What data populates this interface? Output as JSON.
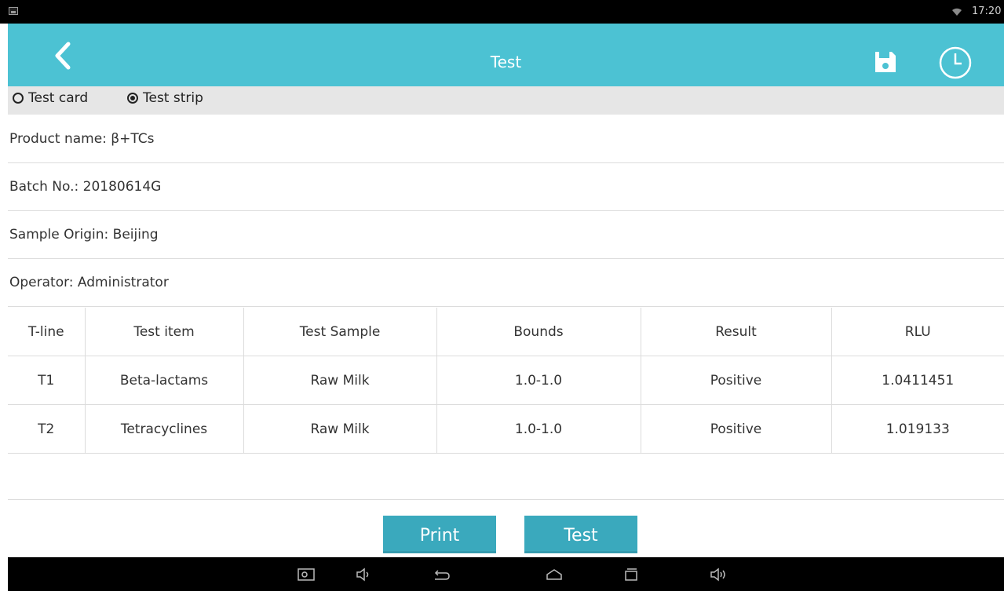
{
  "status_bar": {
    "time": "17:20"
  },
  "app_bar": {
    "title": "Test"
  },
  "mode": {
    "option_card": "Test card",
    "option_strip": "Test strip",
    "selected": "Test strip"
  },
  "info": {
    "product": "Product name: β+TCs",
    "batch": "Batch No.: 20180614G",
    "origin": "Sample Origin: Beijing",
    "operator": "Operator: Administrator"
  },
  "table": {
    "headers": [
      "T-line",
      "Test item",
      "Test Sample",
      "Bounds",
      "Result",
      "RLU"
    ],
    "rows": [
      [
        "T1",
        "Beta-lactams",
        "Raw Milk",
        "1.0-1.0",
        "Positive",
        "1.0411451"
      ],
      [
        "T2",
        "Tetracyclines",
        "Raw Milk",
        "1.0-1.0",
        "Positive",
        "1.019133"
      ]
    ]
  },
  "actions": {
    "print": "Print",
    "test": "Test"
  },
  "icons": {
    "back": "chevron-left-icon",
    "save": "floppy-disk-icon",
    "history": "clock-icon",
    "nav": [
      "screenshot-icon",
      "volume-down-icon",
      "back-icon",
      "home-icon",
      "recent-apps-icon",
      "volume-up-icon"
    ]
  },
  "colors": {
    "accent": "#4cc2d3",
    "button": "#3aa9bd",
    "mode_row": "#e6e6e6"
  }
}
